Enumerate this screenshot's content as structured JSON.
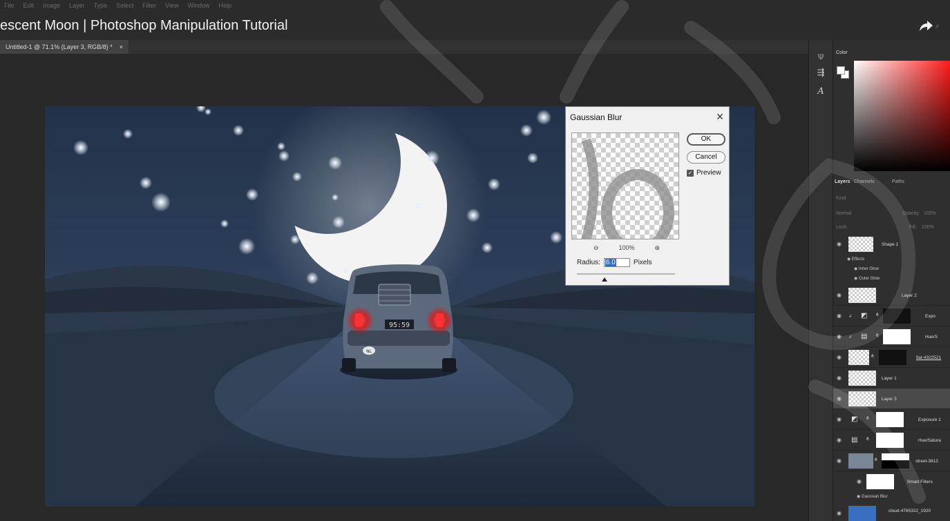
{
  "menu": [
    "File",
    "Edit",
    "Image",
    "Layer",
    "Type",
    "Select",
    "Filter",
    "View",
    "Window",
    "Help"
  ],
  "video_title": "escent Moon | Photoshop Manipulation Tutorial",
  "document_tab": {
    "label": "Untitled-1 @ 71.1% (Layer 3, RGB/8) *",
    "close": "×"
  },
  "artwork": {
    "license_plate": "95:59",
    "badge": "NL"
  },
  "dialog": {
    "title": "Gaussian Blur",
    "close": "×",
    "ok_label": "OK",
    "cancel_label": "Cancel",
    "preview_label": "Preview",
    "preview_checked": true,
    "zoom_out": "⊖",
    "zoom_level": "100%",
    "zoom_in": "⊕",
    "radius_label": "Radius:",
    "radius_value": "6.0",
    "radius_unit": "Pixels"
  },
  "dock_icons": [
    "move-tool-icon",
    "adjust-icon",
    "type-icon"
  ],
  "color_panel": {
    "tab": "Color",
    "fg": "#ffffff",
    "bg": "#ffffff",
    "hue": "#ff1a1a"
  },
  "layers_panel": {
    "tabs": [
      "Layers",
      "Channels",
      "Paths"
    ],
    "kind": "Kind",
    "blend_mode": "Normal",
    "opacity_label": "Opacity:",
    "opacity_value": "100%",
    "lock_label": "Lock:",
    "fill_label": "Fill:",
    "fill_value": "100%",
    "layers": [
      {
        "name": "Shape 1"
      },
      {
        "name": "Effects",
        "sub": true
      },
      {
        "name": "Inner Glow",
        "sub": true
      },
      {
        "name": "Outer Glow",
        "sub": true
      },
      {
        "name": "Layer 2"
      },
      {
        "name": "Expo"
      },
      {
        "name": "Hue/S"
      },
      {
        "name": "fiat-4322521"
      },
      {
        "name": "Layer 1"
      },
      {
        "name": "Layer 3"
      },
      {
        "name": "Exposure 1"
      },
      {
        "name": "Hue/Satura"
      },
      {
        "name": "street-3812"
      },
      {
        "name": "Smart Filters"
      },
      {
        "name": "Gaussian Blur"
      },
      {
        "name": "cloud-4765322_1920"
      }
    ]
  }
}
